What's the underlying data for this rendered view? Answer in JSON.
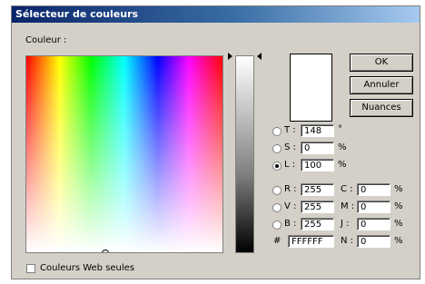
{
  "window": {
    "title": "Sélecteur de couleurs"
  },
  "picker": {
    "label": "Couleur :"
  },
  "color": {
    "hex_preview": "#FFFFFF"
  },
  "buttons": {
    "ok": "OK",
    "cancel": "Annuler",
    "swatches": "Nuances"
  },
  "hsb": [
    {
      "id": "t",
      "label": "T :",
      "value": "148",
      "unit": "°",
      "checked": false
    },
    {
      "id": "s",
      "label": "S :",
      "value": "0",
      "unit": "%",
      "checked": false
    },
    {
      "id": "l",
      "label": "L :",
      "value": "100",
      "unit": "%",
      "checked": true
    }
  ],
  "rgb": [
    {
      "id": "r",
      "label": "R :",
      "value": "255"
    },
    {
      "id": "v",
      "label": "V :",
      "value": "255"
    },
    {
      "id": "b",
      "label": "B :",
      "value": "255"
    }
  ],
  "cmyk": [
    {
      "id": "c",
      "label": "C :",
      "value": "0",
      "unit": "%"
    },
    {
      "id": "m",
      "label": "M :",
      "value": "0",
      "unit": "%"
    },
    {
      "id": "j",
      "label": "J :",
      "value": "0",
      "unit": "%"
    },
    {
      "id": "n",
      "label": "N :",
      "value": "0",
      "unit": "%"
    }
  ],
  "hex": {
    "symbol": "#",
    "value": "FFFFFF"
  },
  "web_only": {
    "label": "Couleurs Web seules",
    "checked": false
  }
}
